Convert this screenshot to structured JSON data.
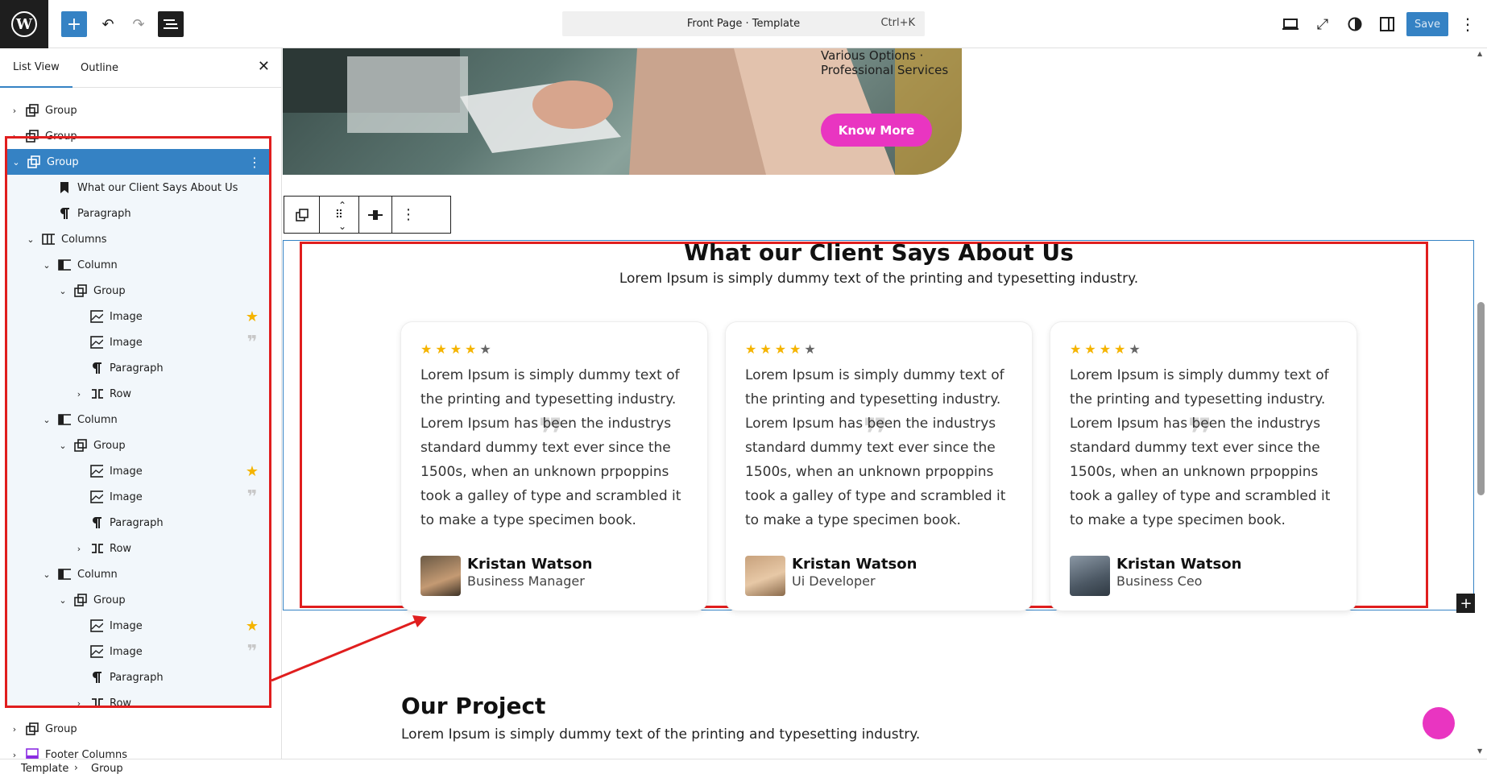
{
  "topbar": {
    "command_title": "Front Page · Template",
    "command_shortcut": "Ctrl+K",
    "save_label": "Save"
  },
  "sidebar": {
    "tabs": [
      "List View",
      "Outline"
    ],
    "rows": [
      {
        "label": "Group"
      },
      {
        "label": "Group"
      },
      {
        "label": "Group"
      },
      {
        "label": "What our Client Says About Us"
      },
      {
        "label": "Paragraph"
      },
      {
        "label": "Columns"
      },
      {
        "label": "Column"
      },
      {
        "label": "Group"
      },
      {
        "label": "Image"
      },
      {
        "label": "Image"
      },
      {
        "label": "Paragraph"
      },
      {
        "label": "Row"
      },
      {
        "label": "Column"
      },
      {
        "label": "Group"
      },
      {
        "label": "Image"
      },
      {
        "label": "Image"
      },
      {
        "label": "Paragraph"
      },
      {
        "label": "Row"
      },
      {
        "label": "Column"
      },
      {
        "label": "Group"
      },
      {
        "label": "Image"
      },
      {
        "label": "Image"
      },
      {
        "label": "Paragraph"
      },
      {
        "label": "Row"
      },
      {
        "label": "Group"
      },
      {
        "label": "Footer Columns"
      }
    ]
  },
  "breadcrumb": [
    "Template",
    "Group"
  ],
  "canvas": {
    "hero_text": "Various Options · Professional Services",
    "know_more": "Know More",
    "section_title": "What our Client Says About Us",
    "section_subtitle": "Lorem Ipsum is simply dummy text of the printing and typesetting industry.",
    "testimonials": [
      {
        "rating": 4,
        "text": "Lorem Ipsum is simply dummy text of the printing and typesetting industry. Lorem Ipsum has been the industrys standard dummy text ever since the 1500s, when an unknown prpoppins took a galley of type and scrambled it to make a type specimen book.",
        "name": "Kristan Watson",
        "role": "Business Manager"
      },
      {
        "rating": 4,
        "text": "Lorem Ipsum is simply dummy text of the printing and typesetting industry. Lorem Ipsum has been the industrys standard dummy text ever since the 1500s, when an unknown prpoppins took a galley of type and scrambled it to make a type specimen book.",
        "name": "Kristan Watson",
        "role": "Ui Developer"
      },
      {
        "rating": 4,
        "text": "Lorem Ipsum is simply dummy text of the printing and typesetting industry. Lorem Ipsum has been the industrys standard dummy text ever since the 1500s, when an unknown prpoppins took a galley of type and scrambled it to make a type specimen book.",
        "name": "Kristan Watson",
        "role": "Business Ceo"
      }
    ],
    "project_title": "Our Project",
    "project_subtitle": "Lorem Ipsum is simply dummy text of the printing and typesetting industry."
  },
  "colors": {
    "accent": "#3582c4",
    "pink": "#e935c1",
    "highlight": "#e01e1e",
    "star": "#f5b400"
  }
}
